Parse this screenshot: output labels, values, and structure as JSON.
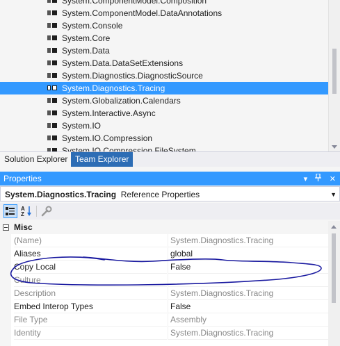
{
  "tree": {
    "items": [
      {
        "label": "System.ComponentModel.Composition",
        "selected": false
      },
      {
        "label": "System.ComponentModel.DataAnnotations",
        "selected": false
      },
      {
        "label": "System.Console",
        "selected": false
      },
      {
        "label": "System.Core",
        "selected": false
      },
      {
        "label": "System.Data",
        "selected": false
      },
      {
        "label": "System.Data.DataSetExtensions",
        "selected": false
      },
      {
        "label": "System.Diagnostics.DiagnosticSource",
        "selected": false
      },
      {
        "label": "System.Diagnostics.Tracing",
        "selected": true
      },
      {
        "label": "System.Globalization.Calendars",
        "selected": false
      },
      {
        "label": "System.Interactive.Async",
        "selected": false
      },
      {
        "label": "System.IO",
        "selected": false
      },
      {
        "label": "System.IO.Compression",
        "selected": false
      },
      {
        "label": "System.IO.Compression.FileSystem",
        "selected": false
      }
    ]
  },
  "tabs": {
    "solution_explorer": "Solution Explorer",
    "team_explorer": "Team Explorer"
  },
  "properties": {
    "title": "Properties",
    "title_buttons": {
      "dropdown": "▾",
      "pin": "📌",
      "close": "✕"
    },
    "object_name": "System.Diagnostics.Tracing",
    "object_type": "Reference Properties",
    "category": "Misc",
    "rows": [
      {
        "name": "(Name)",
        "value": "System.Diagnostics.Tracing",
        "name_grey": true,
        "value_grey": true
      },
      {
        "name": "Aliases",
        "value": "global",
        "name_grey": false,
        "value_grey": false
      },
      {
        "name": "Copy Local",
        "value": "False",
        "name_grey": false,
        "value_grey": false
      },
      {
        "name": "Culture",
        "value": "",
        "name_grey": true,
        "value_grey": true
      },
      {
        "name": "Description",
        "value": "System.Diagnostics.Tracing",
        "name_grey": true,
        "value_grey": true
      },
      {
        "name": "Embed Interop Types",
        "value": "False",
        "name_grey": false,
        "value_grey": false
      },
      {
        "name": "File Type",
        "value": "Assembly",
        "name_grey": true,
        "value_grey": true
      },
      {
        "name": "Identity",
        "value": "System.Diagnostics.Tracing",
        "name_grey": true,
        "value_grey": true
      }
    ]
  },
  "colors": {
    "selection": "#3399ff",
    "annotation_ink": "#1a1aa0"
  }
}
